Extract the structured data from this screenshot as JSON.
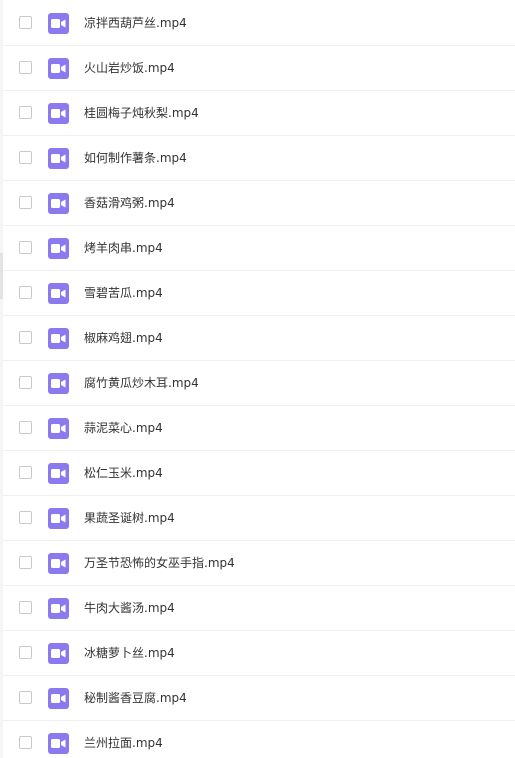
{
  "file_list": {
    "items": [
      {
        "name": "凉拌西葫芦丝.mp4",
        "type_icon": "video-file-icon",
        "checked": false
      },
      {
        "name": "火山岩炒饭.mp4",
        "type_icon": "video-file-icon",
        "checked": false
      },
      {
        "name": "桂圆梅子炖秋梨.mp4",
        "type_icon": "video-file-icon",
        "checked": false
      },
      {
        "name": "如何制作薯条.mp4",
        "type_icon": "video-file-icon",
        "checked": false
      },
      {
        "name": "香菇滑鸡粥.mp4",
        "type_icon": "video-file-icon",
        "checked": false
      },
      {
        "name": "烤羊肉串.mp4",
        "type_icon": "video-file-icon",
        "checked": false
      },
      {
        "name": "雪碧苦瓜.mp4",
        "type_icon": "video-file-icon",
        "checked": false
      },
      {
        "name": "椒麻鸡翅.mp4",
        "type_icon": "video-file-icon",
        "checked": false
      },
      {
        "name": "腐竹黄瓜炒木耳.mp4",
        "type_icon": "video-file-icon",
        "checked": false
      },
      {
        "name": "蒜泥菜心.mp4",
        "type_icon": "video-file-icon",
        "checked": false
      },
      {
        "name": "松仁玉米.mp4",
        "type_icon": "video-file-icon",
        "checked": false
      },
      {
        "name": "果蔬圣诞树.mp4",
        "type_icon": "video-file-icon",
        "checked": false
      },
      {
        "name": "万圣节恐怖的女巫手指.mp4",
        "type_icon": "video-file-icon",
        "checked": false
      },
      {
        "name": "牛肉大酱汤.mp4",
        "type_icon": "video-file-icon",
        "checked": false
      },
      {
        "name": "冰糖萝卜丝.mp4",
        "type_icon": "video-file-icon",
        "checked": false
      },
      {
        "name": "秘制酱香豆腐.mp4",
        "type_icon": "video-file-icon",
        "checked": false
      },
      {
        "name": "兰州拉面.mp4",
        "type_icon": "video-file-icon",
        "checked": false
      }
    ]
  },
  "colors": {
    "video_icon": "#8b79f0",
    "text": "#333333",
    "divider": "#f0f0f0",
    "checkbox_border": "#c9c9c9"
  }
}
